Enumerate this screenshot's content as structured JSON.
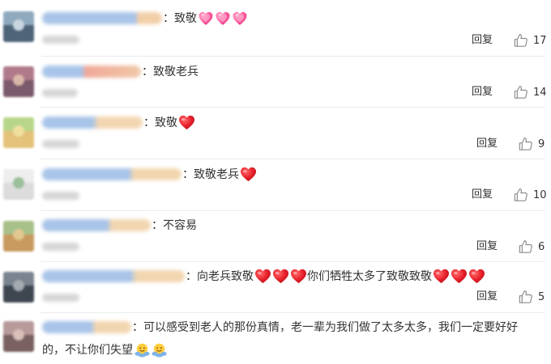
{
  "reply_label": "回复",
  "colors": {
    "text": "#333333",
    "heart": "#e8202a",
    "pink_heart": "#ff5fa2",
    "divider": "#ececec"
  },
  "comments": [
    {
      "text": "：致敬",
      "emoji": [
        "pink-heart",
        "pink-heart",
        "pink-heart"
      ],
      "likes": "17"
    },
    {
      "text": "：致敬老兵",
      "emoji": [],
      "likes": "14"
    },
    {
      "text": "：致敬",
      "emoji": [
        "red-heart"
      ],
      "likes": "9"
    },
    {
      "text": "：致敬老兵",
      "emoji": [
        "red-heart"
      ],
      "likes": "10"
    },
    {
      "text": "：不容易",
      "emoji": [],
      "likes": "6"
    },
    {
      "text": "：向老兵致敬",
      "emoji": [
        "red-heart",
        "red-heart",
        "red-heart"
      ],
      "text_2": "你们牺牲太多了致敬致敬",
      "emoji_2": [
        "red-heart",
        "red-heart",
        "red-heart"
      ],
      "likes": "5"
    },
    {
      "text": "：可以感受到老人的那份真情，老一辈为我们做了太多太多，我们一定要好好",
      "text_2": "的，不让你们失望",
      "emoji_2": [
        "hugging-face",
        "hugging-face"
      ]
    }
  ]
}
